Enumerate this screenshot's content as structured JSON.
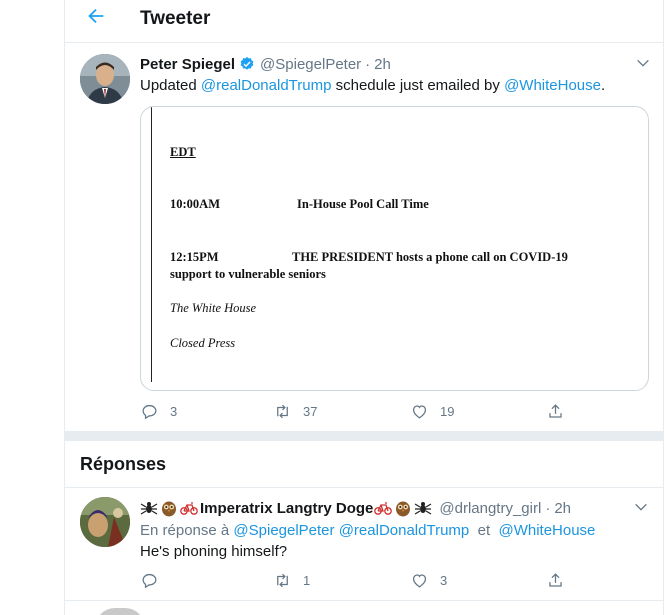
{
  "header": {
    "title": "Tweeter"
  },
  "tweet": {
    "display_name": "Peter Spiegel",
    "handle": "@SpiegelPeter",
    "separator": "·",
    "time": "2h",
    "text_prefix": "Updated ",
    "mention_1": "@realDonaldTrump",
    "text_middle": " schedule just emailed by ",
    "mention_2": "@WhiteHouse",
    "text_suffix": ".",
    "media": {
      "edt": "EDT",
      "row1_time": "10:00AM",
      "row1_event": "In-House Pool Call Time",
      "row2_time": "12:15PM",
      "row2_event": "THE PRESIDENT hosts a phone call on COVID-19 support to vulnerable seniors",
      "location": "The White House",
      "press": "Closed Press"
    },
    "actions": {
      "replies": "3",
      "retweets": "37",
      "likes": "19"
    }
  },
  "replies_section": {
    "title": "Réponses"
  },
  "reply": {
    "display_name": "Imperatrix Langtry Doge",
    "handle": "@drlangtry_girl",
    "separator": "·",
    "time": "2h",
    "reply_prefix": "En réponse à ",
    "to_1": "@SpiegelPeter",
    "to_2": "@realDonaldTrump",
    "conj": "et",
    "to_3": "@WhiteHouse",
    "text": "He's phoning himself?",
    "actions": {
      "replies": "",
      "retweets": "1",
      "likes": "3"
    }
  },
  "colors": {
    "accent": "#1da1f2",
    "link": "#1b95e0",
    "muted": "#657786",
    "border": "#e6ecf0"
  }
}
